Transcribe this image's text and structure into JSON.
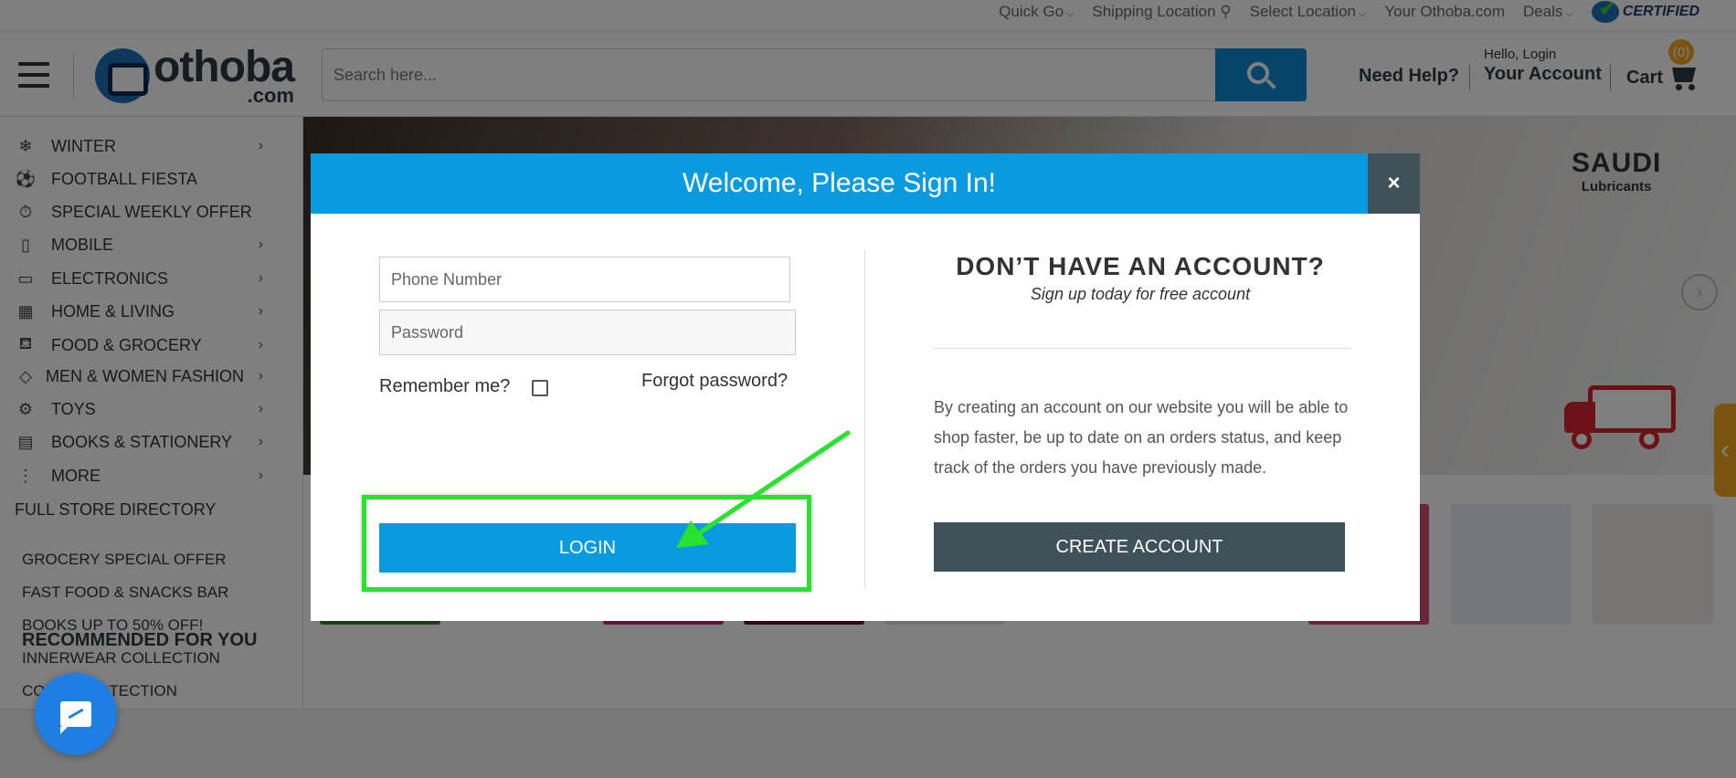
{
  "topbar": {
    "links": [
      {
        "label": "Quick Go",
        "caret": true
      },
      {
        "label": "Shipping Location",
        "caret": false
      },
      {
        "label": "Select Location",
        "caret": true
      },
      {
        "label": "Your Othoba.com",
        "caret": false
      },
      {
        "label": "Deals",
        "caret": true
      }
    ],
    "certified": "CERTIFIED"
  },
  "header": {
    "logo_brand": "othoba",
    "logo_domain": ".com",
    "search_placeholder": "Search here...",
    "need_help": "Need Help?",
    "hello": "Hello, Login",
    "your_account": "Your Account",
    "cart_label": "Cart",
    "cart_count": "(0)"
  },
  "sidebar": {
    "categories": [
      {
        "label": "WINTER",
        "icon": "snowflake-icon",
        "glyph": "❄",
        "chevron": true
      },
      {
        "label": "FOOTBALL FIESTA",
        "icon": "football-icon",
        "glyph": "⚽",
        "chevron": false
      },
      {
        "label": "SPECIAL WEEKLY OFFER",
        "icon": "offer-icon",
        "glyph": "⏱",
        "chevron": false
      },
      {
        "label": "MOBILE",
        "icon": "mobile-icon",
        "glyph": "▯",
        "chevron": true
      },
      {
        "label": "ELECTRONICS",
        "icon": "electronics-icon",
        "glyph": "▭",
        "chevron": true
      },
      {
        "label": "HOME & LIVING",
        "icon": "home-icon",
        "glyph": "▦",
        "chevron": true
      },
      {
        "label": "FOOD & GROCERY",
        "icon": "basket-icon",
        "glyph": "⛾",
        "chevron": true
      },
      {
        "label": "MEN & WOMEN FASHION",
        "icon": "fashion-icon",
        "glyph": "◇",
        "chevron": true
      },
      {
        "label": "TOYS",
        "icon": "toys-icon",
        "glyph": "⚙",
        "chevron": true
      },
      {
        "label": "BOOKS & STATIONERY",
        "icon": "book-icon",
        "glyph": "▤",
        "chevron": true
      },
      {
        "label": "MORE",
        "icon": "more-icon",
        "glyph": "⋮",
        "chevron": true
      }
    ],
    "full_directory": "FULL STORE DIRECTORY",
    "promos": [
      "GROCERY SPECIAL OFFER",
      "FAST FOOD & SNACKS BAR",
      "BOOKS UP TO 50% OFF!",
      "INNERWEAR COLLECTION",
      "COVID PROTECTION"
    ],
    "recommended": "RECOMMENDED FOR YOU"
  },
  "banner": {
    "brand_line1": "SAUDI",
    "brand_line2": "Lubricants"
  },
  "modal": {
    "title": "Welcome, Please Sign In!",
    "close_glyph": "×",
    "phone_placeholder": "Phone Number",
    "password_placeholder": "Password",
    "remember_label": "Remember me?",
    "forgot_label": "Forgot password?",
    "login_label": "LOGIN",
    "right_title": "DON’T HAVE AN ACCOUNT?",
    "right_subtitle": "Sign up today for free account",
    "right_description": "By creating an account on our website you will be able to shop faster, be up to date on an orders status, and keep track of the orders you have previously made.",
    "create_label": "CREATE ACCOUNT"
  },
  "colors": {
    "primary_blue": "#0a9ae0",
    "dark_slate": "#3f5159",
    "highlight_green": "#27e32d",
    "cart_orange": "#f5a623"
  }
}
